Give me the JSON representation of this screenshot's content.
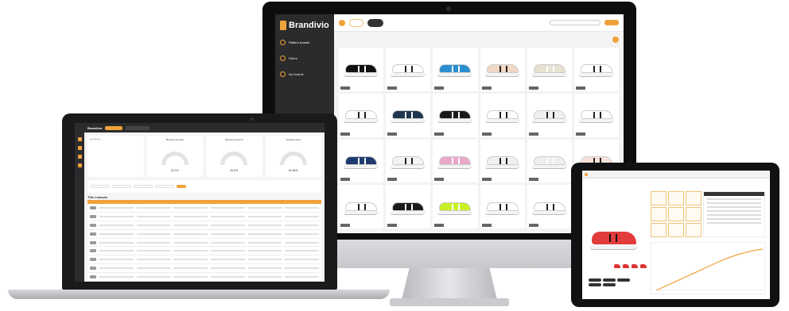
{
  "imac": {
    "brand": "Brandivio",
    "nav": [
      {
        "label": "Pattern boards"
      },
      {
        "label": "Filters"
      },
      {
        "label": "My boards"
      }
    ],
    "shoe_rows": [
      [
        "#111111",
        "#ffffff",
        "#2a8fd0",
        "#f1d8c4",
        "#e8e2d2",
        "#ffffff"
      ],
      [
        "#ffffff",
        "#1f3550",
        "#1a1a1a",
        "#ffffff",
        "#f0f0f0",
        "#ffffff"
      ],
      [
        "#1e3a6e",
        "#f4f4f4",
        "#e9a8c8",
        "#f0f0f0",
        "#eeeeee",
        "#f6e2d8"
      ],
      [
        "#ffffff",
        "#1b1b1b",
        "#c8f025",
        "#ffffff",
        "#ffffff",
        "#f3b3c8"
      ]
    ],
    "accent": "#f0a23a"
  },
  "laptop": {
    "brand": "Brandivio",
    "gauges": [
      {
        "title": "Meeting demand",
        "value": "29.7%"
      },
      {
        "title": "Meeting demand",
        "value": "49.5%"
      },
      {
        "title": "Attractiveness",
        "value": "61.84%"
      }
    ],
    "table_title": "Title example"
  },
  "tablet": {
    "accent": "#f0a23a"
  }
}
